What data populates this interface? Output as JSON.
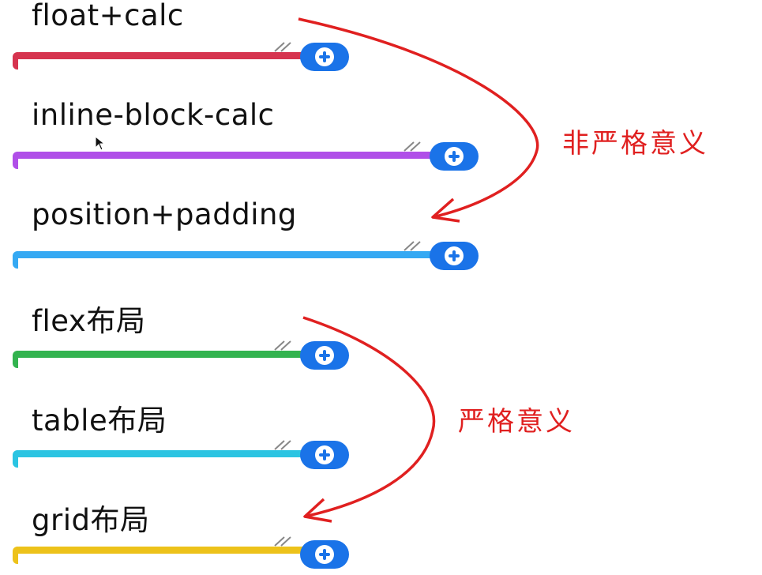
{
  "nodes": [
    {
      "label": "float+calc",
      "color": "#d6344f"
    },
    {
      "label": "inline-block-calc",
      "color": "#b04fe8"
    },
    {
      "label": "position+padding",
      "color": "#35a9f3"
    },
    {
      "label": "flex布局",
      "color": "#33b34f"
    },
    {
      "label": "table布局",
      "color": "#2bc4e2"
    },
    {
      "label": "grid布局",
      "color": "#edc21a"
    }
  ],
  "annotations": {
    "non_strict": "非严格意义",
    "strict": "严格意义"
  },
  "colors": {
    "arrow": "#e02020",
    "plus_button": "#1a73e8"
  },
  "icons": [
    "plus-icon",
    "mouse-cursor-icon"
  ]
}
